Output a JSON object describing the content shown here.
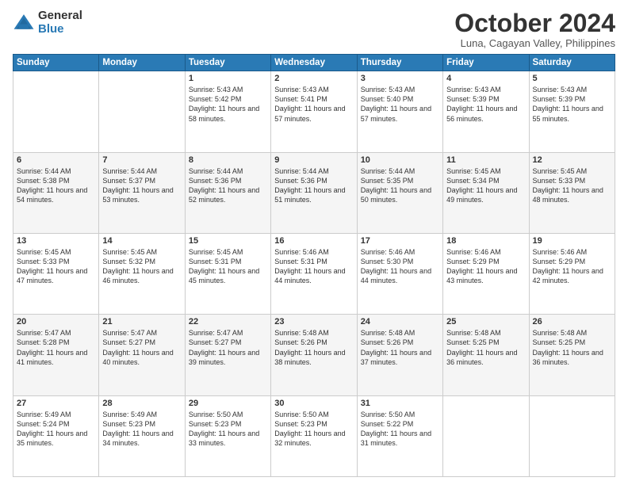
{
  "header": {
    "logo_general": "General",
    "logo_blue": "Blue",
    "month_title": "October 2024",
    "location": "Luna, Cagayan Valley, Philippines"
  },
  "days_of_week": [
    "Sunday",
    "Monday",
    "Tuesday",
    "Wednesday",
    "Thursday",
    "Friday",
    "Saturday"
  ],
  "weeks": [
    [
      {
        "day": "",
        "sunrise": "",
        "sunset": "",
        "daylight": ""
      },
      {
        "day": "",
        "sunrise": "",
        "sunset": "",
        "daylight": ""
      },
      {
        "day": "1",
        "sunrise": "Sunrise: 5:43 AM",
        "sunset": "Sunset: 5:42 PM",
        "daylight": "Daylight: 11 hours and 58 minutes."
      },
      {
        "day": "2",
        "sunrise": "Sunrise: 5:43 AM",
        "sunset": "Sunset: 5:41 PM",
        "daylight": "Daylight: 11 hours and 57 minutes."
      },
      {
        "day": "3",
        "sunrise": "Sunrise: 5:43 AM",
        "sunset": "Sunset: 5:40 PM",
        "daylight": "Daylight: 11 hours and 57 minutes."
      },
      {
        "day": "4",
        "sunrise": "Sunrise: 5:43 AM",
        "sunset": "Sunset: 5:39 PM",
        "daylight": "Daylight: 11 hours and 56 minutes."
      },
      {
        "day": "5",
        "sunrise": "Sunrise: 5:43 AM",
        "sunset": "Sunset: 5:39 PM",
        "daylight": "Daylight: 11 hours and 55 minutes."
      }
    ],
    [
      {
        "day": "6",
        "sunrise": "Sunrise: 5:44 AM",
        "sunset": "Sunset: 5:38 PM",
        "daylight": "Daylight: 11 hours and 54 minutes."
      },
      {
        "day": "7",
        "sunrise": "Sunrise: 5:44 AM",
        "sunset": "Sunset: 5:37 PM",
        "daylight": "Daylight: 11 hours and 53 minutes."
      },
      {
        "day": "8",
        "sunrise": "Sunrise: 5:44 AM",
        "sunset": "Sunset: 5:36 PM",
        "daylight": "Daylight: 11 hours and 52 minutes."
      },
      {
        "day": "9",
        "sunrise": "Sunrise: 5:44 AM",
        "sunset": "Sunset: 5:36 PM",
        "daylight": "Daylight: 11 hours and 51 minutes."
      },
      {
        "day": "10",
        "sunrise": "Sunrise: 5:44 AM",
        "sunset": "Sunset: 5:35 PM",
        "daylight": "Daylight: 11 hours and 50 minutes."
      },
      {
        "day": "11",
        "sunrise": "Sunrise: 5:45 AM",
        "sunset": "Sunset: 5:34 PM",
        "daylight": "Daylight: 11 hours and 49 minutes."
      },
      {
        "day": "12",
        "sunrise": "Sunrise: 5:45 AM",
        "sunset": "Sunset: 5:33 PM",
        "daylight": "Daylight: 11 hours and 48 minutes."
      }
    ],
    [
      {
        "day": "13",
        "sunrise": "Sunrise: 5:45 AM",
        "sunset": "Sunset: 5:33 PM",
        "daylight": "Daylight: 11 hours and 47 minutes."
      },
      {
        "day": "14",
        "sunrise": "Sunrise: 5:45 AM",
        "sunset": "Sunset: 5:32 PM",
        "daylight": "Daylight: 11 hours and 46 minutes."
      },
      {
        "day": "15",
        "sunrise": "Sunrise: 5:45 AM",
        "sunset": "Sunset: 5:31 PM",
        "daylight": "Daylight: 11 hours and 45 minutes."
      },
      {
        "day": "16",
        "sunrise": "Sunrise: 5:46 AM",
        "sunset": "Sunset: 5:31 PM",
        "daylight": "Daylight: 11 hours and 44 minutes."
      },
      {
        "day": "17",
        "sunrise": "Sunrise: 5:46 AM",
        "sunset": "Sunset: 5:30 PM",
        "daylight": "Daylight: 11 hours and 44 minutes."
      },
      {
        "day": "18",
        "sunrise": "Sunrise: 5:46 AM",
        "sunset": "Sunset: 5:29 PM",
        "daylight": "Daylight: 11 hours and 43 minutes."
      },
      {
        "day": "19",
        "sunrise": "Sunrise: 5:46 AM",
        "sunset": "Sunset: 5:29 PM",
        "daylight": "Daylight: 11 hours and 42 minutes."
      }
    ],
    [
      {
        "day": "20",
        "sunrise": "Sunrise: 5:47 AM",
        "sunset": "Sunset: 5:28 PM",
        "daylight": "Daylight: 11 hours and 41 minutes."
      },
      {
        "day": "21",
        "sunrise": "Sunrise: 5:47 AM",
        "sunset": "Sunset: 5:27 PM",
        "daylight": "Daylight: 11 hours and 40 minutes."
      },
      {
        "day": "22",
        "sunrise": "Sunrise: 5:47 AM",
        "sunset": "Sunset: 5:27 PM",
        "daylight": "Daylight: 11 hours and 39 minutes."
      },
      {
        "day": "23",
        "sunrise": "Sunrise: 5:48 AM",
        "sunset": "Sunset: 5:26 PM",
        "daylight": "Daylight: 11 hours and 38 minutes."
      },
      {
        "day": "24",
        "sunrise": "Sunrise: 5:48 AM",
        "sunset": "Sunset: 5:26 PM",
        "daylight": "Daylight: 11 hours and 37 minutes."
      },
      {
        "day": "25",
        "sunrise": "Sunrise: 5:48 AM",
        "sunset": "Sunset: 5:25 PM",
        "daylight": "Daylight: 11 hours and 36 minutes."
      },
      {
        "day": "26",
        "sunrise": "Sunrise: 5:48 AM",
        "sunset": "Sunset: 5:25 PM",
        "daylight": "Daylight: 11 hours and 36 minutes."
      }
    ],
    [
      {
        "day": "27",
        "sunrise": "Sunrise: 5:49 AM",
        "sunset": "Sunset: 5:24 PM",
        "daylight": "Daylight: 11 hours and 35 minutes."
      },
      {
        "day": "28",
        "sunrise": "Sunrise: 5:49 AM",
        "sunset": "Sunset: 5:23 PM",
        "daylight": "Daylight: 11 hours and 34 minutes."
      },
      {
        "day": "29",
        "sunrise": "Sunrise: 5:50 AM",
        "sunset": "Sunset: 5:23 PM",
        "daylight": "Daylight: 11 hours and 33 minutes."
      },
      {
        "day": "30",
        "sunrise": "Sunrise: 5:50 AM",
        "sunset": "Sunset: 5:23 PM",
        "daylight": "Daylight: 11 hours and 32 minutes."
      },
      {
        "day": "31",
        "sunrise": "Sunrise: 5:50 AM",
        "sunset": "Sunset: 5:22 PM",
        "daylight": "Daylight: 11 hours and 31 minutes."
      },
      {
        "day": "",
        "sunrise": "",
        "sunset": "",
        "daylight": ""
      },
      {
        "day": "",
        "sunrise": "",
        "sunset": "",
        "daylight": ""
      }
    ]
  ]
}
